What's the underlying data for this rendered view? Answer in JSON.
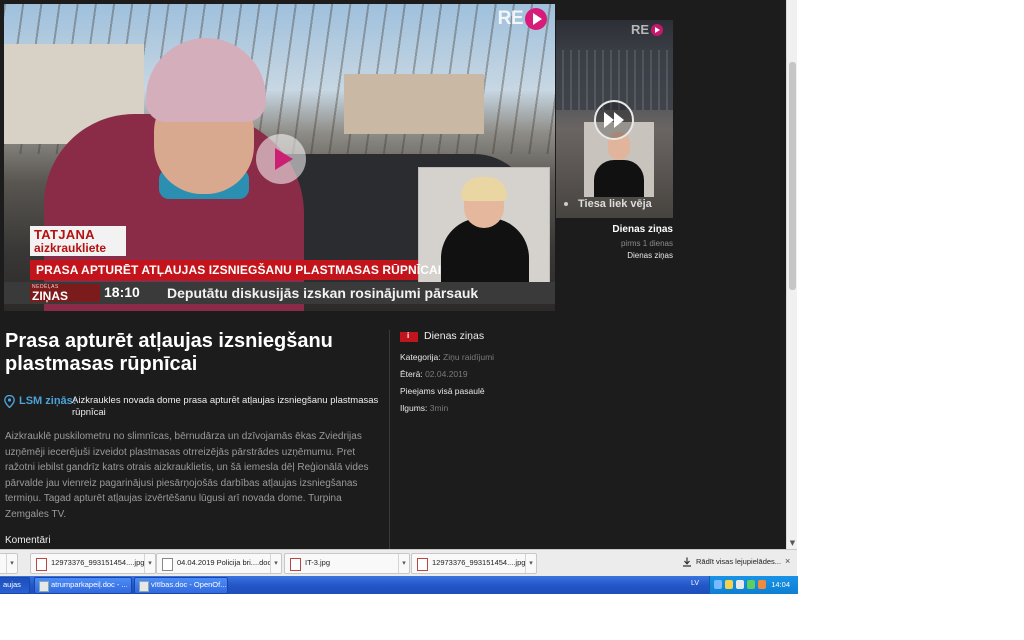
{
  "main_video": {
    "logo_text": "RE",
    "name_title": "TATJANA",
    "name_subtitle": "aizkrauklietе",
    "headline": "PRASA APTURĒT ATĻAUJAS IZSNIEGŠANU PLASTMASAS  RŪPNĪCAI",
    "news_logo_small": "NEDĒĻAS",
    "news_logo": "ZIŅAS",
    "ticker_time": "18:10",
    "ticker_text": "Deputātu diskusijās izskan rosinājumi pārsauk"
  },
  "side_video": {
    "logo_text": "RE",
    "caption": "Tiesa liek vēja",
    "title": "Dienas ziņas",
    "time": "pirms 1 dienas",
    "show": "Dienas ziņas"
  },
  "article": {
    "title": "Prasa apturēt atļaujas izsniegšanu plastmasas rūpnīcai",
    "source_label": "LSM ziņās:",
    "source_text": "Aizkraukles novada dome prasa apturēt atļaujas izsniegšanu plastmasas rūpnīcai",
    "body": "Aizkrauklē puskilometru no slimnīcas, bērnudārza un dzīvojamās ēkas Zviedrijas uzņēmēji iecerējuši izveidot plastmasas otrreizējās pārstrādes uzņēmumu. Pret ražotni iebilst gandrīz katrs otrais aizkrauklietis, un šā iemesla dēļ Reģionālā vides pārvalde jau vienreiz pagarinājusi piesārņojošās darbības atļaujas izsniegšanas termiņu. Tagad apturēt atļaujas izvērtēšanu lūgusi arī novada dome. Turpina Zemgales TV.",
    "comments_label": "Komentāri"
  },
  "info": {
    "show_name": "Dienas ziņas",
    "category_key": "Kategorija:",
    "category_val": "Ziņu raidījumi",
    "aired_key": "Ēterā:",
    "aired_val": "02.04.2019",
    "availability": "Pieejams visā pasaulē",
    "duration_key": "Ilgums:",
    "duration_val": "3min"
  },
  "downloads": {
    "items": [
      {
        "name": "12973376_993151454....jpg",
        "type": "image"
      },
      {
        "name": "04.04.2019 Policija bri....doc",
        "type": "doc"
      },
      {
        "name": "IT-3.jpg",
        "type": "image"
      },
      {
        "name": "12973376_993151454....jpg",
        "type": "image"
      }
    ],
    "show_all": "Rādīt visas lejupielādes...",
    "close": "×"
  },
  "taskbar": {
    "items": [
      {
        "label": "aujas"
      },
      {
        "label": "atrumparkapeiļ.doc - ..."
      },
      {
        "label": "vītības.doc - OpenOf..."
      }
    ],
    "lang": "LV",
    "time": "14:04"
  },
  "colors": {
    "page_bg": "#1c1c1c",
    "accent_red": "#c4141b",
    "link_blue": "#4ba3d9",
    "brand_pink": "#d81b7a",
    "taskbar_blue": "#2457c9"
  }
}
